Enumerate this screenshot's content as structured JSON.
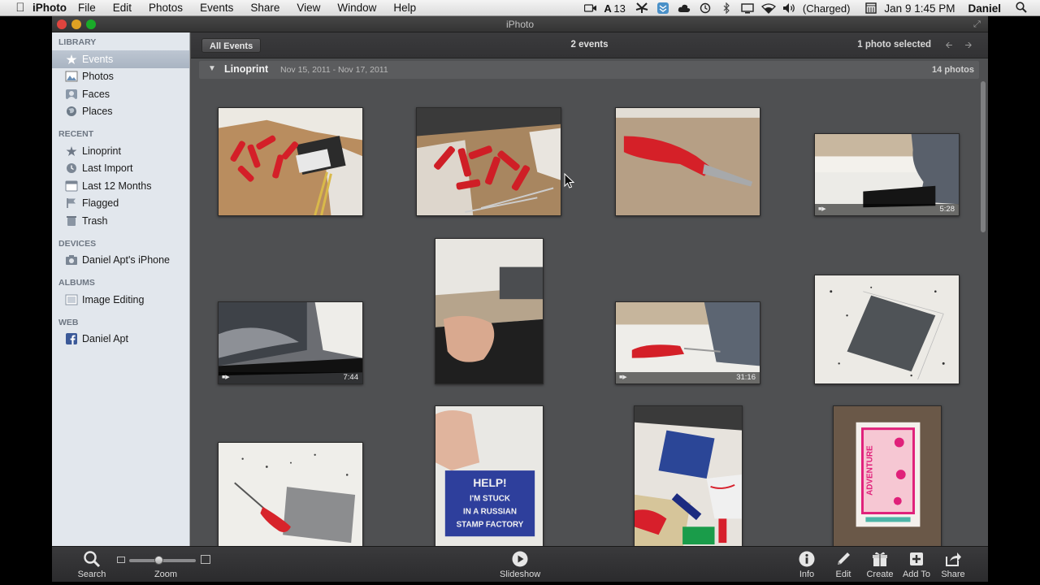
{
  "menubar": {
    "app_name": "iPhoto",
    "items": [
      "File",
      "Edit",
      "Photos",
      "Events",
      "Share",
      "View",
      "Window",
      "Help"
    ],
    "badge_count": "13",
    "battery_status": "(Charged)",
    "datetime": "Jan 9  1:45 PM",
    "user": "Daniel"
  },
  "window": {
    "title": "iPhoto"
  },
  "sidebar": {
    "library_header": "LIBRARY",
    "library": [
      "Events",
      "Photos",
      "Faces",
      "Places"
    ],
    "recent_header": "RECENT",
    "recent": [
      "Linoprint",
      "Last Import",
      "Last 12 Months",
      "Flagged",
      "Trash"
    ],
    "devices_header": "DEVICES",
    "devices": [
      "Daniel Apt's iPhone"
    ],
    "albums_header": "ALBUMS",
    "albums": [
      "Image Editing"
    ],
    "web_header": "WEB",
    "web": [
      "Daniel Apt"
    ],
    "selected": "Events"
  },
  "content": {
    "all_events_label": "All Events",
    "events_count": "2 events",
    "selection_status": "1 photo selected",
    "event_name": "Linoprint",
    "event_dates": "Nov 15, 2011 - Nov 17, 2011",
    "photo_count": "14 photos",
    "video_durations": [
      "5:28",
      "7:44",
      "31:16"
    ]
  },
  "toolbar": {
    "search_label": "Search",
    "zoom_label": "Zoom",
    "zoom_level": 0.45,
    "slideshow_label": "Slideshow",
    "info_label": "Info",
    "edit_label": "Edit",
    "create_label": "Create",
    "addto_label": "Add To",
    "share_label": "Share"
  },
  "colors": {
    "sidebar_bg": "#e2e7ed",
    "content_bg": "#4f5052",
    "selection": "#a9b4c2",
    "toolbar_bg": "#2b2b2d"
  }
}
